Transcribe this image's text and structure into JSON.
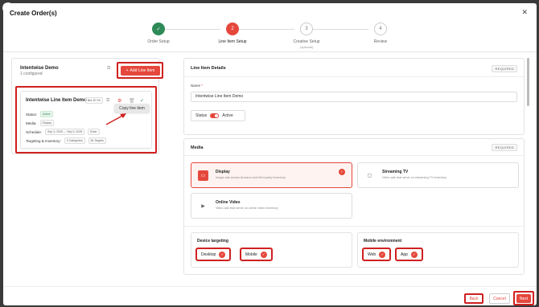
{
  "modal": {
    "title": "Create Order(s)",
    "close_glyph": "✕"
  },
  "stepper": {
    "steps": [
      {
        "number": "✓",
        "label": "Order Setup",
        "status": "done"
      },
      {
        "number": "2",
        "label": "Line Item Setup",
        "status": "active"
      },
      {
        "number": "3",
        "label": "Creative Setup",
        "sublabel": "(optional)",
        "status": "pending"
      },
      {
        "number": "4",
        "label": "Review",
        "status": "pending"
      }
    ]
  },
  "left_panel": {
    "title": "Intentwise Demo",
    "subtitle": "1 configured",
    "add_button_label": "Add Line Item",
    "add_button_glyph": "+",
    "line_item_card": {
      "title": "Intentwise Line Item Demo",
      "id_chip": "Bid: $7.00",
      "status_label": "Status:",
      "status_value": "Active",
      "media_label": "Media:",
      "media_value": "Display",
      "schedule_label": "Schedule:",
      "schedule_start": "Sep 3, 2025 → Sep 3, 2025",
      "schedule_extra": "Enter",
      "targeting_label": "Targeting & Inventory:",
      "targeting_categories": "3 Categories",
      "targeting_targets": "5k Targets"
    },
    "tooltip": "Copy line item"
  },
  "line_item_details": {
    "heading": "Line Item Details",
    "required_badge": "REQUIRED",
    "name_label": "Name",
    "name_required": "*",
    "name_value": "Intentwise Line Item Demo",
    "status_label": "Status",
    "status_value": "Active"
  },
  "media": {
    "heading": "Media",
    "required_badge": "REQUIRED",
    "options": [
      {
        "title": "Display",
        "desc": "Image ads across Amazon and third-party inventory",
        "icon": "monitor-icon",
        "selected": true
      },
      {
        "title": "Streaming TV",
        "desc": "Video ads that serve on streaming TV inventory",
        "icon": "tv-icon",
        "selected": false
      },
      {
        "title": "Online Video",
        "desc": "Video ads that serve on online video inventory",
        "icon": "video-icon",
        "selected": false
      }
    ]
  },
  "device_targeting": {
    "heading": "Device targeting",
    "options": [
      "Desktop",
      "Mobile"
    ]
  },
  "mobile_environment": {
    "heading": "Mobile environment",
    "options": [
      "Web",
      "App"
    ]
  },
  "footer": {
    "back_label": "Back",
    "cancel_label": "Cancel",
    "next_label": "Next"
  },
  "colors": {
    "accent": "#e5473c",
    "success": "#2e8b57",
    "highlight": "#d02020"
  }
}
